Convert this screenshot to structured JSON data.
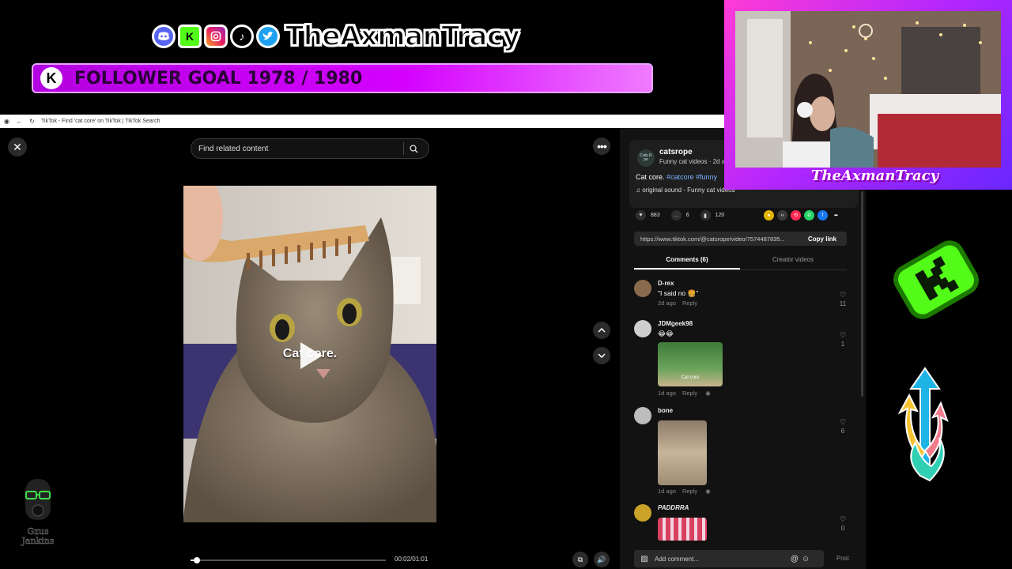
{
  "overlay": {
    "social_icons": [
      "discord-icon",
      "kick-icon",
      "instagram-icon",
      "tiktok-icon",
      "twitter-icon"
    ],
    "handle": "TheAxmanTracy",
    "goal_badge": "K",
    "goal_text": "FOLLOWER GOAL 1978 / 1980",
    "cam_name": "TheAxmanTracy",
    "bottom_left_name": "Gzus Jankins",
    "colors": {
      "goal_bar": "#d400ff",
      "webcam_frame": "#b026ff",
      "kick_green": "#53fc18"
    }
  },
  "browser": {
    "tab_title": "TikTok - Find 'cat core' on TikTok | TikTok Search"
  },
  "search": {
    "placeholder": "Find related content"
  },
  "video": {
    "caption": "Cat core.",
    "time": "00:02/01:01",
    "progress": 0.033
  },
  "author": {
    "avatar_text": "Cats R pe",
    "name": "catsrope",
    "subtitle": "Funny cat videos · 2d a",
    "description": "Cat core.",
    "tags": [
      "#catcore",
      "#funny"
    ],
    "sound": "original sound - Funny cat videos"
  },
  "stats": {
    "likes": "883",
    "comments": "6",
    "saves": "120"
  },
  "share": {
    "url": "https://www.tiktok.com/@catsrope/video/7574487835...",
    "copy_label": "Copy link",
    "icons": [
      {
        "name": "coin-icon",
        "color": "#e3b505"
      },
      {
        "name": "embed-icon",
        "color": "#3a3a3a"
      },
      {
        "name": "repost-icon",
        "color": "#fe2c55"
      },
      {
        "name": "whatsapp-icon",
        "color": "#25d366"
      },
      {
        "name": "facebook-icon",
        "color": "#1877f2"
      },
      {
        "name": "share-arrow-icon",
        "color": "#121212"
      }
    ]
  },
  "tabs": {
    "comments": "Comments (6)",
    "creator_videos": "Creator videos"
  },
  "comments": [
    {
      "user": "D-rex",
      "text": "\"I said no 🍔\"",
      "time": "2d ago",
      "reply": "Reply",
      "likes": "11"
    },
    {
      "user": "JDMgeek98",
      "text": "😂😂",
      "time": "1d ago",
      "reply": "Reply",
      "likes": "1",
      "image_caption": "Cat core"
    },
    {
      "user": "bone",
      "text": "",
      "time": "1d ago",
      "reply": "Reply",
      "likes": "6"
    },
    {
      "user": "PADDRRA",
      "text": "",
      "likes": "0"
    }
  ],
  "comment_box": {
    "placeholder": "Add comment...",
    "post": "Post"
  }
}
